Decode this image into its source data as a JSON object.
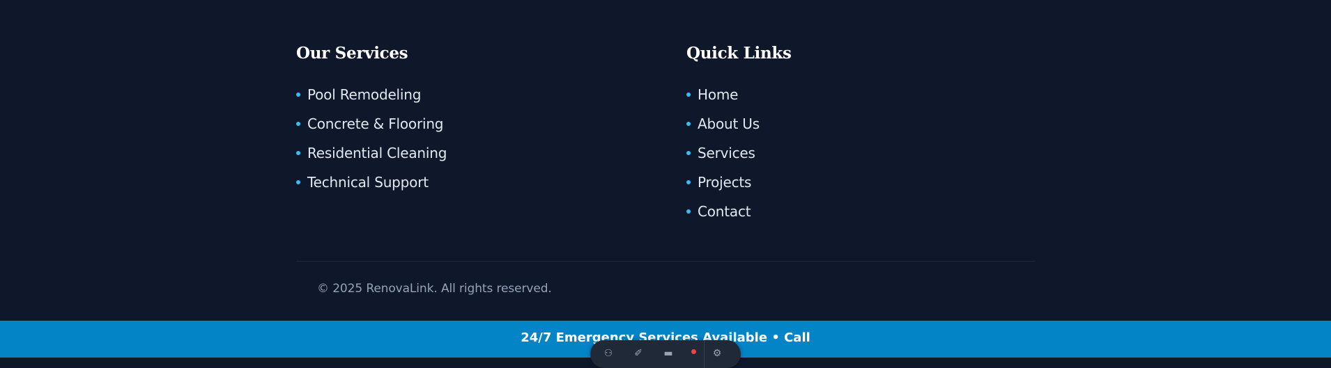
{
  "services": {
    "title": "Our Services",
    "items": [
      {
        "label": "Pool Remodeling"
      },
      {
        "label": "Concrete & Flooring"
      },
      {
        "label": "Residential Cleaning"
      },
      {
        "label": "Technical Support"
      }
    ]
  },
  "quick_links": {
    "title": "Quick Links",
    "items": [
      {
        "label": "Home"
      },
      {
        "label": "About Us"
      },
      {
        "label": "Services"
      },
      {
        "label": "Projects"
      },
      {
        "label": "Contact"
      }
    ]
  },
  "footer": {
    "copyright": "© 2025 RenovaLink. All rights reserved."
  },
  "banner": {
    "text": "24/7 Emergency Services Available • Call"
  },
  "dev_toolbar": {
    "icons": [
      "accessibility-icon",
      "brush-icon",
      "menu-icon",
      "settings-icon"
    ],
    "badge_color": "#ef4444"
  },
  "colors": {
    "background": "#0f172a",
    "accent": "#38bdf8",
    "banner": "#0284c7"
  }
}
